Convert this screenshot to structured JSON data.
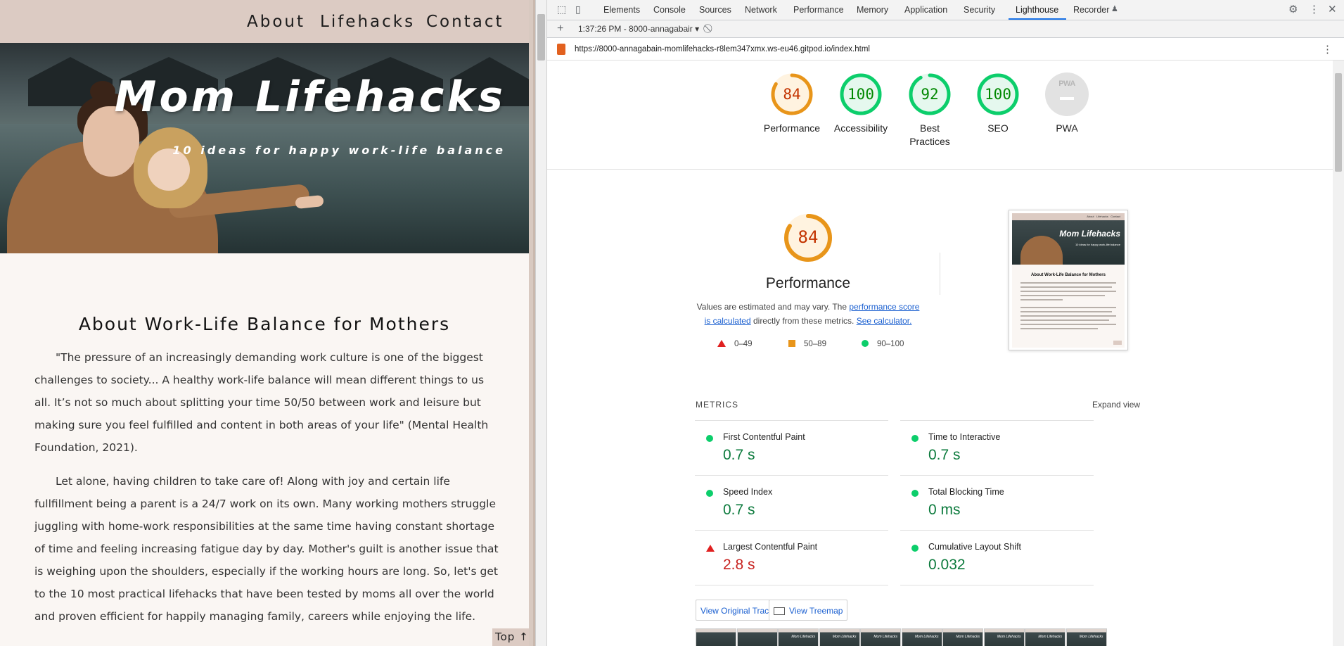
{
  "site": {
    "nav": [
      "About",
      "Lifehacks",
      "Contact"
    ],
    "hero_title": "Mom Lifehacks",
    "hero_subtitle": "10 ideas for happy work-life balance",
    "heading": "About Work-Life Balance for Mothers",
    "paragraph1": "\"The pressure of an increasingly demanding work culture is one of the biggest challenges to society... A healthy work-life balance will mean different things to us all. It’s not so much about splitting your time 50/50 between work and leisure but making sure you feel fulfilled and content in both areas of your life\" (Mental Health Foundation, 2021).",
    "paragraph2": "Let alone, having children to take care of! Along with joy and certain life fullfillment being a parent is a 24/7 work on its own. Many working mothers struggle juggling with home-work responsibilities at the same time having constant shortage of time and feeling increasing fatigue day by day. Mother's guilt is another issue that is weighing upon the shoulders, especially if the working hours are long. So, let's get to the 10 most practical lifehacks that have been tested by moms all over the world and proven efficient for happily managing family, careers while enjoying the life.",
    "top_button": "Top ↑"
  },
  "devtools": {
    "tabs": [
      "Elements",
      "Console",
      "Sources",
      "Network",
      "Performance",
      "Memory",
      "Application",
      "Security",
      "Lighthouse",
      "Recorder"
    ],
    "active_tab": "Lighthouse",
    "report_label": "1:37:26 PM - 8000-annagabair",
    "url": "https://8000-annagabain-momlifehacks-r8lem347xmx.ws-eu46.gitpod.io/index.html"
  },
  "lighthouse": {
    "categories": [
      {
        "label": "Performance",
        "score": "84",
        "fraction": 0.84,
        "color": "#e8951a",
        "text_color": "#c33300"
      },
      {
        "label": "Accessibility",
        "score": "100",
        "fraction": 1.0,
        "color": "#0cce6b",
        "text_color": "#008800"
      },
      {
        "label": "Best Practices",
        "score": "92",
        "fraction": 0.92,
        "color": "#0cce6b",
        "text_color": "#008800"
      },
      {
        "label": "SEO",
        "score": "100",
        "fraction": 1.0,
        "color": "#0cce6b",
        "text_color": "#008800"
      },
      {
        "label": "PWA",
        "score": "PWA",
        "fraction": 0,
        "color": "#e2e2e2",
        "text_color": "#b6b6b6"
      }
    ],
    "perf_score": "84",
    "perf_title": "Performance",
    "perf_desc_pre": "Values are estimated and may vary. The ",
    "perf_link1": "performance score is calculated",
    "perf_desc_mid": " directly from these metrics. ",
    "perf_link2": "See calculator.",
    "legend": [
      "0–49",
      "50–89",
      "90–100"
    ],
    "screenshot": {
      "title": "Mom Lifehacks"
    },
    "metrics_title": "METRICS",
    "expand_view": "Expand view",
    "metrics": [
      {
        "name": "First Contentful Paint",
        "value": "0.7 s",
        "status": "good"
      },
      {
        "name": "Time to Interactive",
        "value": "0.7 s",
        "status": "good"
      },
      {
        "name": "Speed Index",
        "value": "0.7 s",
        "status": "good"
      },
      {
        "name": "Total Blocking Time",
        "value": "0 ms",
        "status": "good"
      },
      {
        "name": "Largest Contentful Paint",
        "value": "2.8 s",
        "status": "bad"
      },
      {
        "name": "Cumulative Layout Shift",
        "value": "0.032",
        "status": "good"
      }
    ],
    "view_trace": "View Original Trace",
    "view_treemap": "View Treemap",
    "filmstrip_label": "Mom Lifehacks"
  }
}
